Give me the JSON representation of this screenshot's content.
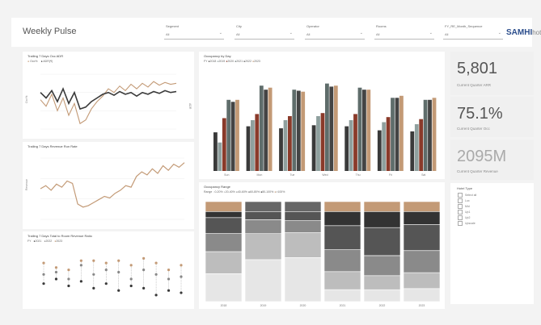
{
  "app_title": "Weekly Pulse",
  "filters": [
    {
      "label": "Segment",
      "value": "All"
    },
    {
      "label": "City",
      "value": "All"
    },
    {
      "label": "Operator",
      "value": "All"
    },
    {
      "label": "Rooms",
      "value": "All"
    },
    {
      "label": "FY_RE_Month_Sequence",
      "value": "All"
    }
  ],
  "logo": {
    "brand": "SAMHI",
    "suffix": "hotels"
  },
  "colors": {
    "tan": "#c39a76",
    "dark": "#3a3a3a",
    "slate": "#5f6d6b",
    "mid": "#8a8a8a",
    "light": "#bdbdbd"
  },
  "panels": {
    "adr": {
      "title": "Trailing 7 Days Occ ADR",
      "legend": [
        "Occ%",
        "ADR(₹)"
      ],
      "yleft": "Occ%",
      "yright": "ADR"
    },
    "revenue": {
      "title": "Trailing 7 Days Revenue Run Rate",
      "ylabel": "Revenue"
    },
    "ratio": {
      "title": "Trailing 7 Days Total to Room Revenue Ratio",
      "legend": [
        "FY",
        "2021",
        "2022",
        "2023"
      ]
    },
    "dow": {
      "title": "Occupancy by Day",
      "legend": [
        "FY",
        "2018",
        "2019",
        "2020",
        "2021",
        "2022",
        "2023"
      ]
    },
    "range": {
      "title": "Occupancy Range",
      "legend_label": "Range",
      "legend": [
        "0-20%",
        "20-40%",
        "40-60%",
        "60-80%",
        "80-100%",
        ">100%"
      ]
    }
  },
  "kpis": [
    {
      "value": "5,801",
      "label": "Current Quarter ARR"
    },
    {
      "value": "75.1%",
      "label": "Current Quarter Occ"
    },
    {
      "value": "2095M",
      "label": "Current Quarter Revenue"
    }
  ],
  "hotel_list": {
    "title": "Hotel Type",
    "items": [
      "Select all",
      "Lux",
      "Mid",
      "Up1",
      "Up2",
      "Upscale"
    ]
  },
  "chart_data": [
    {
      "type": "line",
      "title": "Trailing 7 Days Occ ADR",
      "ylabel": "Occ%",
      "series": [
        {
          "name": "Occ%",
          "values": [
            62,
            55,
            68,
            50,
            64,
            45,
            58,
            36,
            40,
            52,
            60,
            66,
            74,
            70,
            77,
            72,
            79,
            74,
            80,
            76,
            82,
            78,
            81,
            79,
            80
          ]
        },
        {
          "name": "ADR(₹)",
          "values": [
            70,
            64,
            72,
            60,
            74,
            58,
            70,
            52,
            54,
            60,
            64,
            68,
            70,
            67,
            71,
            68,
            70,
            66,
            70,
            68,
            71,
            69,
            72,
            70,
            71
          ]
        }
      ]
    },
    {
      "type": "line",
      "title": "Trailing 7 Days Revenue Run Rate",
      "ylabel": "Revenue",
      "series": [
        {
          "values": [
            40,
            44,
            38,
            46,
            42,
            50,
            47,
            20,
            16,
            18,
            22,
            26,
            30,
            28,
            34,
            38,
            44,
            42,
            56,
            62,
            58,
            66,
            60,
            70,
            64,
            72,
            68,
            74
          ]
        }
      ]
    },
    {
      "type": "line",
      "title": "Occupancy by Day",
      "categories": [
        "Sun",
        "Mon",
        "Tue",
        "Wed",
        "Thu",
        "Fri",
        "Sat"
      ],
      "series": [
        {
          "name": "2018",
          "values": [
            38,
            44,
            42,
            45,
            44,
            40,
            39
          ]
        },
        {
          "name": "2019",
          "values": [
            28,
            50,
            50,
            54,
            50,
            48,
            46
          ]
        },
        {
          "name": "2020",
          "values": [
            52,
            56,
            54,
            57,
            56,
            53,
            51
          ]
        },
        {
          "name": "2021",
          "values": [
            70,
            84,
            80,
            86,
            82,
            72,
            70
          ]
        },
        {
          "name": "2022",
          "values": [
            68,
            80,
            79,
            83,
            80,
            72,
            70
          ]
        },
        {
          "name": "2023",
          "values": [
            70,
            82,
            78,
            84,
            80,
            74,
            72
          ]
        }
      ]
    },
    {
      "type": "area",
      "title": "Occupancy Range",
      "categories": [
        "2018",
        "2019",
        "2020",
        "2021",
        "2022",
        "2023"
      ],
      "series": [
        {
          "name": "0-20%",
          "values": [
            28,
            42,
            44,
            12,
            12,
            13
          ]
        },
        {
          "name": "20-40%",
          "values": [
            22,
            26,
            25,
            18,
            14,
            16
          ]
        },
        {
          "name": "40-60%",
          "values": [
            18,
            14,
            12,
            22,
            20,
            22
          ]
        },
        {
          "name": "60-80%",
          "values": [
            16,
            10,
            10,
            24,
            28,
            26
          ]
        },
        {
          "name": "80-100%",
          "values": [
            16,
            8,
            9,
            24,
            26,
            23
          ]
        }
      ]
    }
  ]
}
